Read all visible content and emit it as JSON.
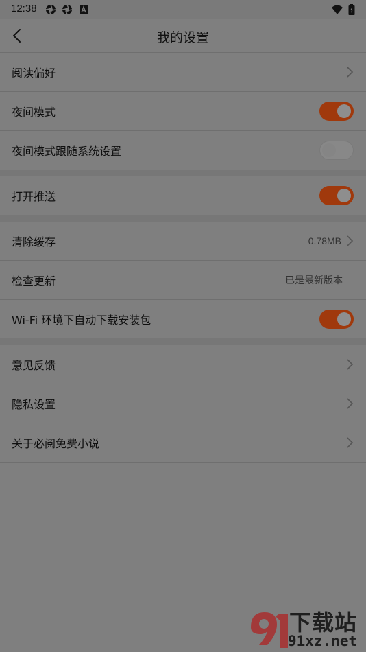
{
  "status_bar": {
    "time": "12:38"
  },
  "header": {
    "title": "我的设置"
  },
  "groups": [
    {
      "rows": [
        {
          "label": "阅读偏好",
          "type": "chevron"
        },
        {
          "label": "夜间模式",
          "type": "toggle",
          "on": true
        },
        {
          "label": "夜间模式跟随系统设置",
          "type": "toggle",
          "on": false
        }
      ]
    },
    {
      "rows": [
        {
          "label": "打开推送",
          "type": "toggle",
          "on": true
        }
      ]
    },
    {
      "rows": [
        {
          "label": "清除缓存",
          "type": "value-chevron",
          "value": "0.78MB"
        },
        {
          "label": "检查更新",
          "type": "value",
          "value": "已是最新版本"
        },
        {
          "label": "Wi-Fi 环境下自动下载安装包",
          "type": "toggle",
          "on": true
        }
      ]
    },
    {
      "rows": [
        {
          "label": "意见反馈",
          "type": "chevron"
        },
        {
          "label": "隐私设置",
          "type": "chevron"
        },
        {
          "label": "关于必阅免费小说",
          "type": "chevron"
        }
      ]
    }
  ],
  "watermark": {
    "cn": "下载站",
    "en": "91xz.net"
  },
  "colors": {
    "accent": "#a0390c",
    "background": "#7f7f7f"
  }
}
